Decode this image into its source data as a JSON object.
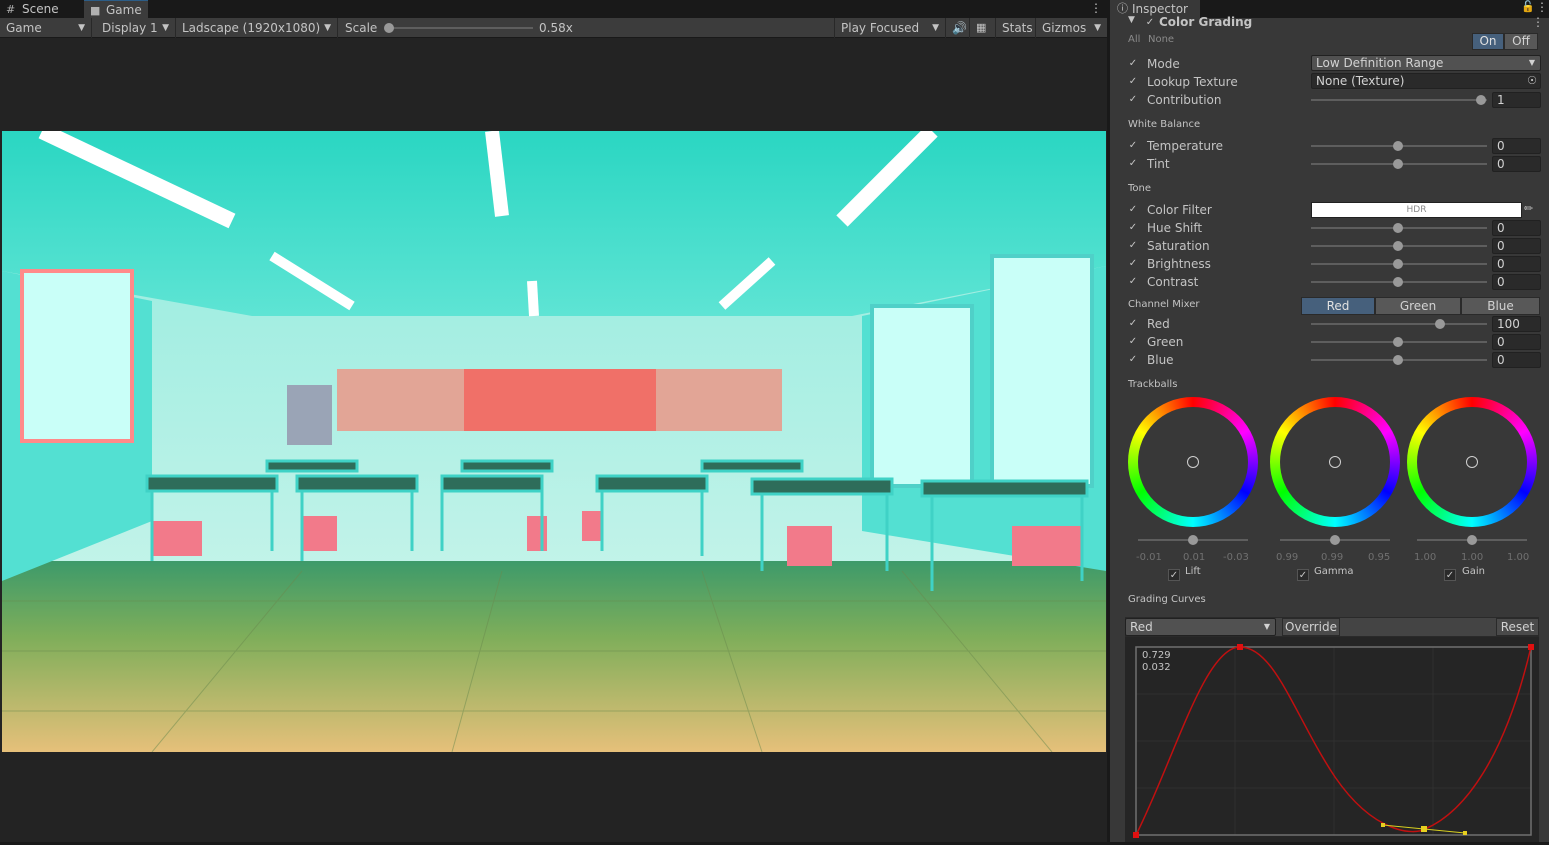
{
  "tabs": {
    "scene": "Scene",
    "game": "Game",
    "inspector": "Inspector"
  },
  "toolbar": {
    "game": "Game",
    "display": "Display 1",
    "aspect": "Ladscape (1920x1080)",
    "scale_label": "Scale",
    "scale_value": "0.58x",
    "scale_fraction": 0.0,
    "play_focused": "Play Focused",
    "stats": "Stats",
    "gizmos": "Gizmos"
  },
  "inspector": {
    "component": "Color Grading",
    "all": "All",
    "none": "None",
    "on": "On",
    "off": "Off",
    "mode_label": "Mode",
    "mode_value": "Low Definition Range",
    "lut_label": "Lookup Texture",
    "lut_value": "None (Texture)",
    "contribution_label": "Contribution",
    "contribution_value": "1",
    "white_balance": "White Balance",
    "temperature": "Temperature",
    "temperature_value": "0",
    "tint": "Tint",
    "tint_value": "0",
    "tone": "Tone",
    "color_filter": "Color Filter",
    "hdr": "HDR",
    "hue_shift": "Hue Shift",
    "hue_shift_value": "0",
    "saturation": "Saturation",
    "saturation_value": "0",
    "brightness": "Brightness",
    "brightness_value": "0",
    "contrast": "Contrast",
    "contrast_value": "0",
    "channel_mixer": "Channel Mixer",
    "mixer_tabs": [
      "Red",
      "Green",
      "Blue"
    ],
    "mixer_red": "Red",
    "mixer_red_value": "100",
    "mixer_green": "Green",
    "mixer_green_value": "0",
    "mixer_blue": "Blue",
    "mixer_blue_value": "0",
    "trackballs": "Trackballs",
    "lift": {
      "label": "Lift",
      "values": [
        "-0.01",
        "0.01",
        "-0.03"
      ]
    },
    "gamma": {
      "label": "Gamma",
      "values": [
        "0.99",
        "0.99",
        "0.95"
      ]
    },
    "gain": {
      "label": "Gain",
      "values": [
        "1.00",
        "1.00",
        "1.00"
      ]
    },
    "grading_curves": "Grading Curves",
    "curve_channel": "Red",
    "override": "Override",
    "reset": "Reset",
    "curve_readout_1": "0.729",
    "curve_readout_2": "0.032"
  },
  "colors": {
    "accent": "#46607c",
    "curve": "#c01010",
    "tab_highlight": "#2c5d87"
  },
  "icons": [
    "scene-grid-icon",
    "gamepad-icon",
    "info-icon",
    "lock-icon",
    "kebab-menu-icon",
    "speaker-icon",
    "keyboard-icon",
    "object-picker-icon",
    "eyedropper-icon"
  ]
}
